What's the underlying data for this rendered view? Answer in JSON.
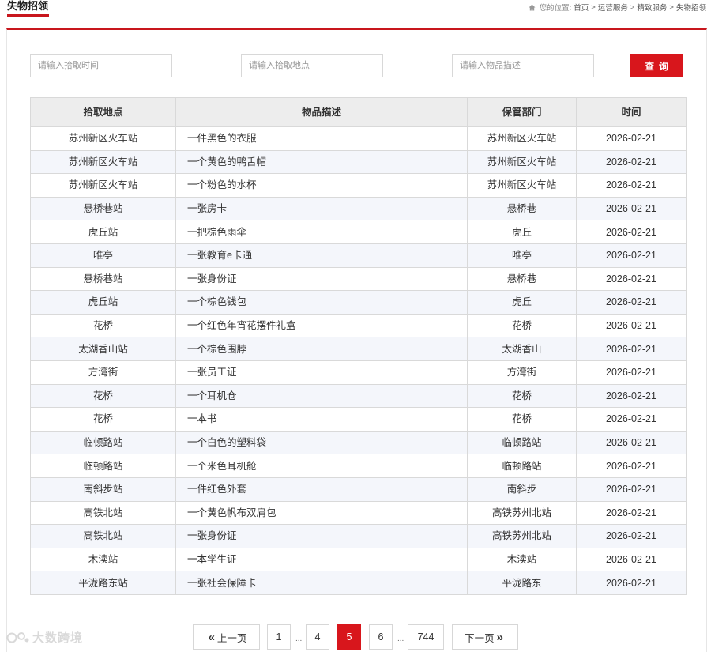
{
  "header": {
    "title": "失物招领",
    "location_label": "您的位置:",
    "breadcrumb": [
      "首页",
      "运营服务",
      "精致服务",
      "失物招领"
    ],
    "separator": ">"
  },
  "search": {
    "time_placeholder": "请输入拾取时间",
    "place_placeholder": "请输入拾取地点",
    "desc_placeholder": "请输入物品描述",
    "query_label": "查询"
  },
  "table": {
    "headers": [
      "拾取地点",
      "物品描述",
      "保管部门",
      "时间"
    ],
    "rows": [
      [
        "苏州新区火车站",
        "一件黑色的衣服",
        "苏州新区火车站",
        "2026-02-21"
      ],
      [
        "苏州新区火车站",
        "一个黄色的鸭舌帽",
        "苏州新区火车站",
        "2026-02-21"
      ],
      [
        "苏州新区火车站",
        "一个粉色的水杯",
        "苏州新区火车站",
        "2026-02-21"
      ],
      [
        "悬桥巷站",
        "一张房卡",
        "悬桥巷",
        "2026-02-21"
      ],
      [
        "虎丘站",
        "一把棕色雨伞",
        "虎丘",
        "2026-02-21"
      ],
      [
        "唯亭",
        "一张教育e卡通",
        "唯亭",
        "2026-02-21"
      ],
      [
        "悬桥巷站",
        "一张身份证",
        "悬桥巷",
        "2026-02-21"
      ],
      [
        "虎丘站",
        "一个棕色钱包",
        "虎丘",
        "2026-02-21"
      ],
      [
        "花桥",
        "一个红色年宵花摆件礼盒",
        "花桥",
        "2026-02-21"
      ],
      [
        "太湖香山站",
        "一个棕色围脖",
        "太湖香山",
        "2026-02-21"
      ],
      [
        "方湾街",
        "一张员工证",
        "方湾街",
        "2026-02-21"
      ],
      [
        "花桥",
        "一个耳机仓",
        "花桥",
        "2026-02-21"
      ],
      [
        "花桥",
        "一本书",
        "花桥",
        "2026-02-21"
      ],
      [
        "临顿路站",
        "一个白色的塑料袋",
        "临顿路站",
        "2026-02-21"
      ],
      [
        "临顿路站",
        "一个米色耳机舱",
        "临顿路站",
        "2026-02-21"
      ],
      [
        "南斜步站",
        "一件红色外套",
        "南斜步",
        "2026-02-21"
      ],
      [
        "高铁北站",
        "一个黄色帆布双肩包",
        "高铁苏州北站",
        "2026-02-21"
      ],
      [
        "高铁北站",
        "一张身份证",
        "高铁苏州北站",
        "2026-02-21"
      ],
      [
        "木渎站",
        "一本学生证",
        "木渎站",
        "2026-02-21"
      ],
      [
        "平泷路东站",
        "一张社会保障卡",
        "平泷路东",
        "2026-02-21"
      ]
    ]
  },
  "pagination": {
    "prev_label": "上一页",
    "next_label": "下一页",
    "prev_chevron": "«",
    "next_chevron": "»",
    "ellipsis": "...",
    "first": "1",
    "before": "4",
    "current": "5",
    "after": "6",
    "last": "744"
  },
  "watermark": {
    "text": "大数跨境"
  },
  "colors": {
    "accent": "#d8161c",
    "header_bg": "#ededed",
    "stripe_bg": "#f4f6fb",
    "border": "#d9d9d9"
  },
  "icons": {
    "home": "home-icon",
    "prev": "double-chevron-left-icon",
    "next": "double-chevron-right-icon"
  }
}
